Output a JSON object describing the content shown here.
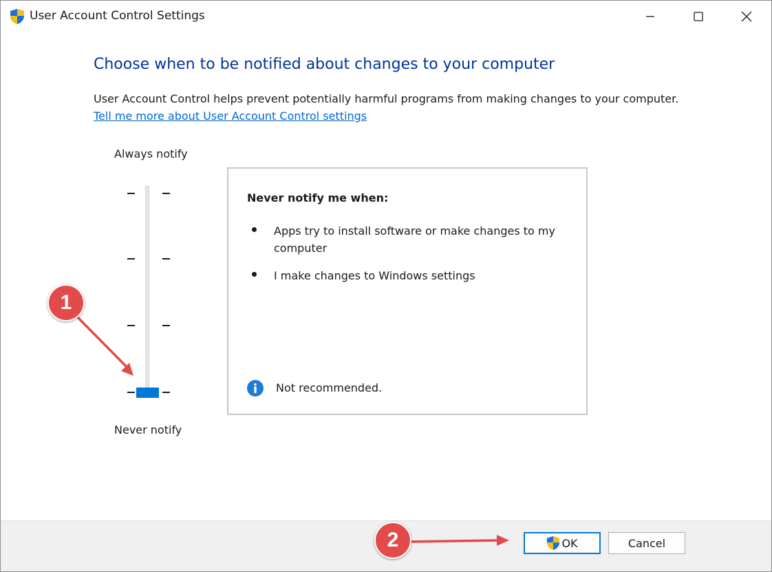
{
  "window": {
    "title": "User Account Control Settings"
  },
  "content": {
    "heading": "Choose when to be notified about changes to your computer",
    "description": "User Account Control helps prevent potentially harmful programs from making changes to your computer.",
    "link": "Tell me more about User Account Control settings"
  },
  "slider": {
    "top_label": "Always notify",
    "bottom_label": "Never notify",
    "levels": 4,
    "selected_level": 1
  },
  "panel": {
    "title": "Never notify me when:",
    "bullets": [
      "Apps try to install software or make changes to my computer",
      "I make changes to Windows settings"
    ],
    "recommendation": "Not recommended."
  },
  "footer": {
    "ok_label": "OK",
    "cancel_label": "Cancel"
  },
  "annotations": {
    "badge_1": "1",
    "badge_2": "2"
  },
  "colors": {
    "heading": "#003399",
    "link": "#0066cc",
    "accent": "#0078d7",
    "annotation": "#e34a4a"
  },
  "icons": {
    "title": "uac-shield-icon",
    "info": "info-icon",
    "ok": "uac-shield-icon"
  }
}
